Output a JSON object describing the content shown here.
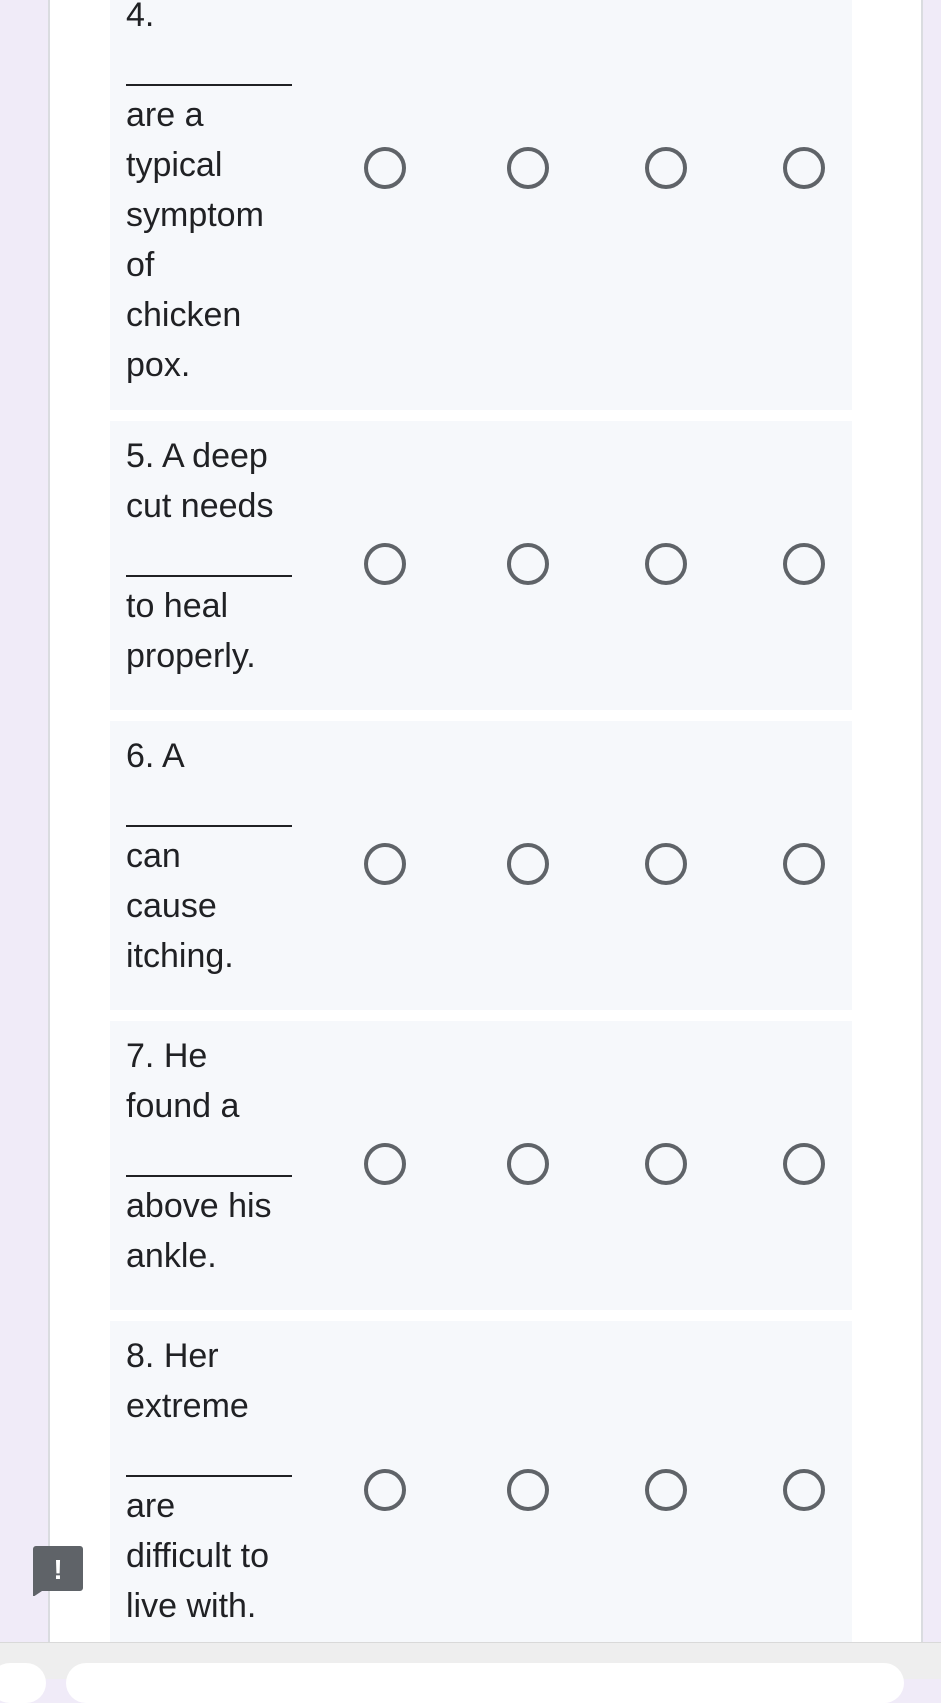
{
  "questions": [
    {
      "number": "4.",
      "lines_before": [],
      "lines_after": [
        "are a",
        "typical",
        "symptom",
        "of",
        "chicken",
        "pox."
      ]
    },
    {
      "number": "5.",
      "lines_before": [
        "A deep",
        "cut needs"
      ],
      "lines_after": [
        "to heal",
        "properly."
      ]
    },
    {
      "number": "6.",
      "lines_before": [
        "A"
      ],
      "lines_after": [
        "can",
        "cause",
        "itching."
      ]
    },
    {
      "number": "7.",
      "lines_before": [
        "He",
        "found a"
      ],
      "lines_after": [
        "above his",
        "ankle."
      ]
    },
    {
      "number": "8.",
      "lines_before": [
        "Her",
        "extreme"
      ],
      "lines_after": [
        "are",
        "difficult to",
        "live with."
      ]
    }
  ],
  "report": {
    "icon": "report-problem-icon",
    "glyph": "!"
  },
  "colors": {
    "page_bg": "#f0ebf8",
    "row_bg": "#f6f8fb",
    "radio_border": "#5f6368",
    "report_icon_bg": "#5f6368"
  }
}
